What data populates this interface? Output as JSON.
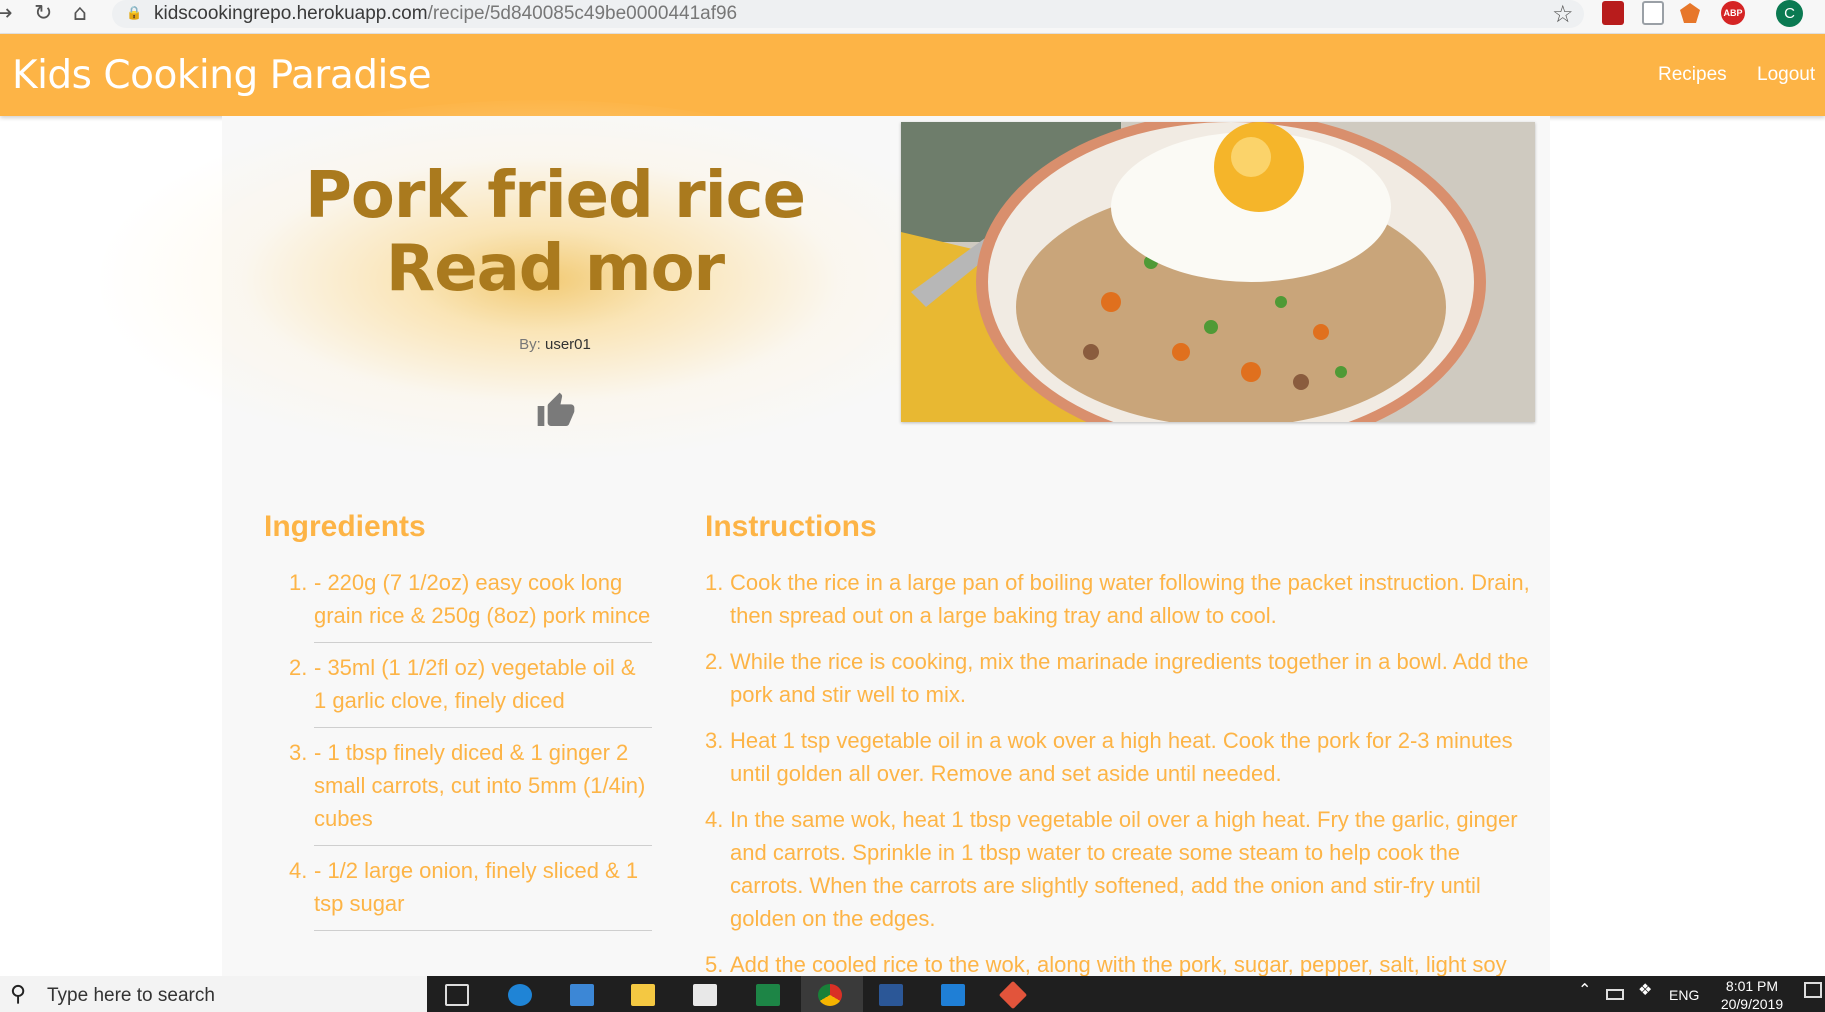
{
  "browser": {
    "url_domain": "kidscookingrepo.herokuapp.com",
    "url_path": "/recipe/5d840085c49be0000441af96",
    "profile_initial": "C",
    "abp_label": "ABP",
    "icons": [
      "back-icon",
      "reload-icon",
      "home-icon",
      "lock-icon",
      "star-icon"
    ]
  },
  "header": {
    "brand": "Kids Cooking Paradise",
    "nav": [
      "Recipes",
      "Logout"
    ],
    "background_color": "#fdb446"
  },
  "recipe": {
    "title": "Pork fried rice Read mor",
    "author_label": "By:",
    "author": "user01",
    "like_icon": "thumbs-up-icon",
    "ingredients_heading": "Ingredients",
    "instructions_heading": "Instructions",
    "ingredients": [
      "- 220g (7 1/2oz) easy cook long grain rice & 250g (8oz) pork mince",
      "- 35ml (1 1/2fl oz) vegetable oil & 1 garlic clove, finely diced",
      "- 1 tbsp finely diced & 1 ginger 2 small carrots, cut into 5mm (1/4in) cubes",
      "- 1/2 large onion, finely sliced & 1 tsp sugar"
    ],
    "instructions": [
      "Cook the rice in a large pan of boiling water following the packet instruction. Drain, then spread out on a large baking tray and allow to cool.",
      "While the rice is cooking, mix the marinade ingredients together in a bowl. Add the pork and stir well to mix.",
      "Heat 1 tsp vegetable oil in a wok over a high heat. Cook the pork for 2-3 minutes until golden all over. Remove and set aside until needed.",
      "In the same wok, heat 1 tbsp vegetable oil over a high heat. Fry the garlic, ginger and carrots. Sprinkle in 1 tbsp water to create some steam to help cook the carrots. When the carrots are slightly softened, add the onion and stir-fry until golden on the edges.",
      "Add the cooled rice to the wok, along with the pork, sugar, pepper, salt, light soy"
    ],
    "accent_color": "#fdb446",
    "title_color": "#aa7a1e"
  },
  "taskbar": {
    "search_placeholder": "Type here to search",
    "apps": [
      "task-view-icon",
      "edge-icon",
      "store-icon",
      "file-explorer-icon",
      "mail-icon",
      "excel-icon",
      "chrome-icon",
      "word-icon",
      "vscode-icon",
      "git-icon"
    ],
    "language": "ENG",
    "time": "8:01 PM",
    "date": "20/9/2019"
  }
}
